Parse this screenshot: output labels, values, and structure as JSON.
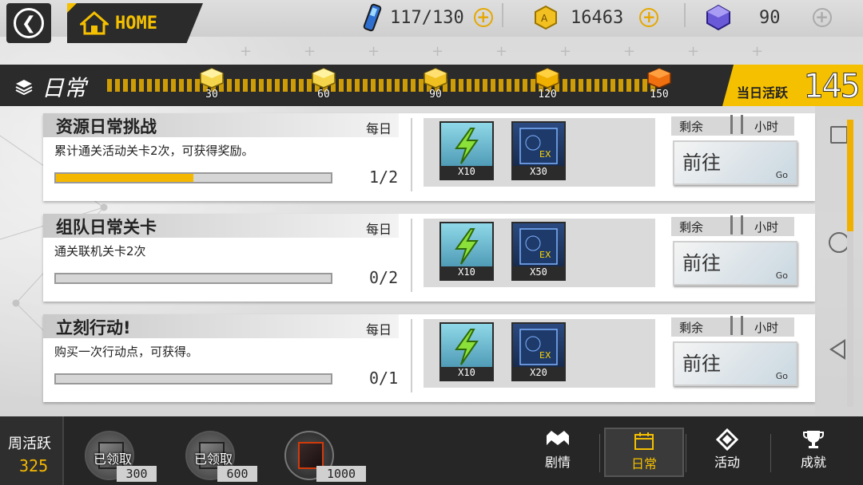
{
  "topbar": {
    "home_label": "HOME",
    "energy_value": "117/130",
    "coin_value": "16463",
    "crystal_value": "90"
  },
  "daily": {
    "title": "日常",
    "milestones": [
      "30",
      "60",
      "90",
      "120",
      "150"
    ],
    "today_label": "当日活跃",
    "today_value": "145"
  },
  "tasks": [
    {
      "name": "资源日常挑战",
      "freq": "每日",
      "desc": "累计通关活动关卡2次，可获得奖励。",
      "progress": "1/2",
      "progress_fraction": 0.5,
      "rewards": [
        "X10",
        "X30"
      ],
      "remain_left": "剩余",
      "remain_right": "小时",
      "go_label": "前往",
      "go_small": "Go"
    },
    {
      "name": "组队日常关卡",
      "freq": "每日",
      "desc": "通关联机关卡2次",
      "progress": "0/2",
      "progress_fraction": 0,
      "rewards": [
        "X10",
        "X50"
      ],
      "remain_left": "剩余",
      "remain_right": "小时",
      "go_label": "前往",
      "go_small": "Go"
    },
    {
      "name": "立刻行动!",
      "freq": "每日",
      "desc": "购买一次行动点，可获得。",
      "progress": "0/1",
      "progress_fraction": 0,
      "rewards": [
        "X10",
        "X20"
      ],
      "remain_left": "剩余",
      "remain_right": "小时",
      "go_label": "前往",
      "go_small": "Go"
    }
  ],
  "weekly": {
    "label": "周活跃",
    "value": "325",
    "chests": [
      {
        "status": "已领取",
        "threshold": "300"
      },
      {
        "status": "已领取",
        "threshold": "600"
      },
      {
        "status": "",
        "threshold": "1000"
      }
    ]
  },
  "nav": {
    "story": "剧情",
    "daily": "日常",
    "activity": "活动",
    "achievement": "成就"
  },
  "colors": {
    "accent": "#f5c000",
    "dark": "#2b2b2b"
  }
}
